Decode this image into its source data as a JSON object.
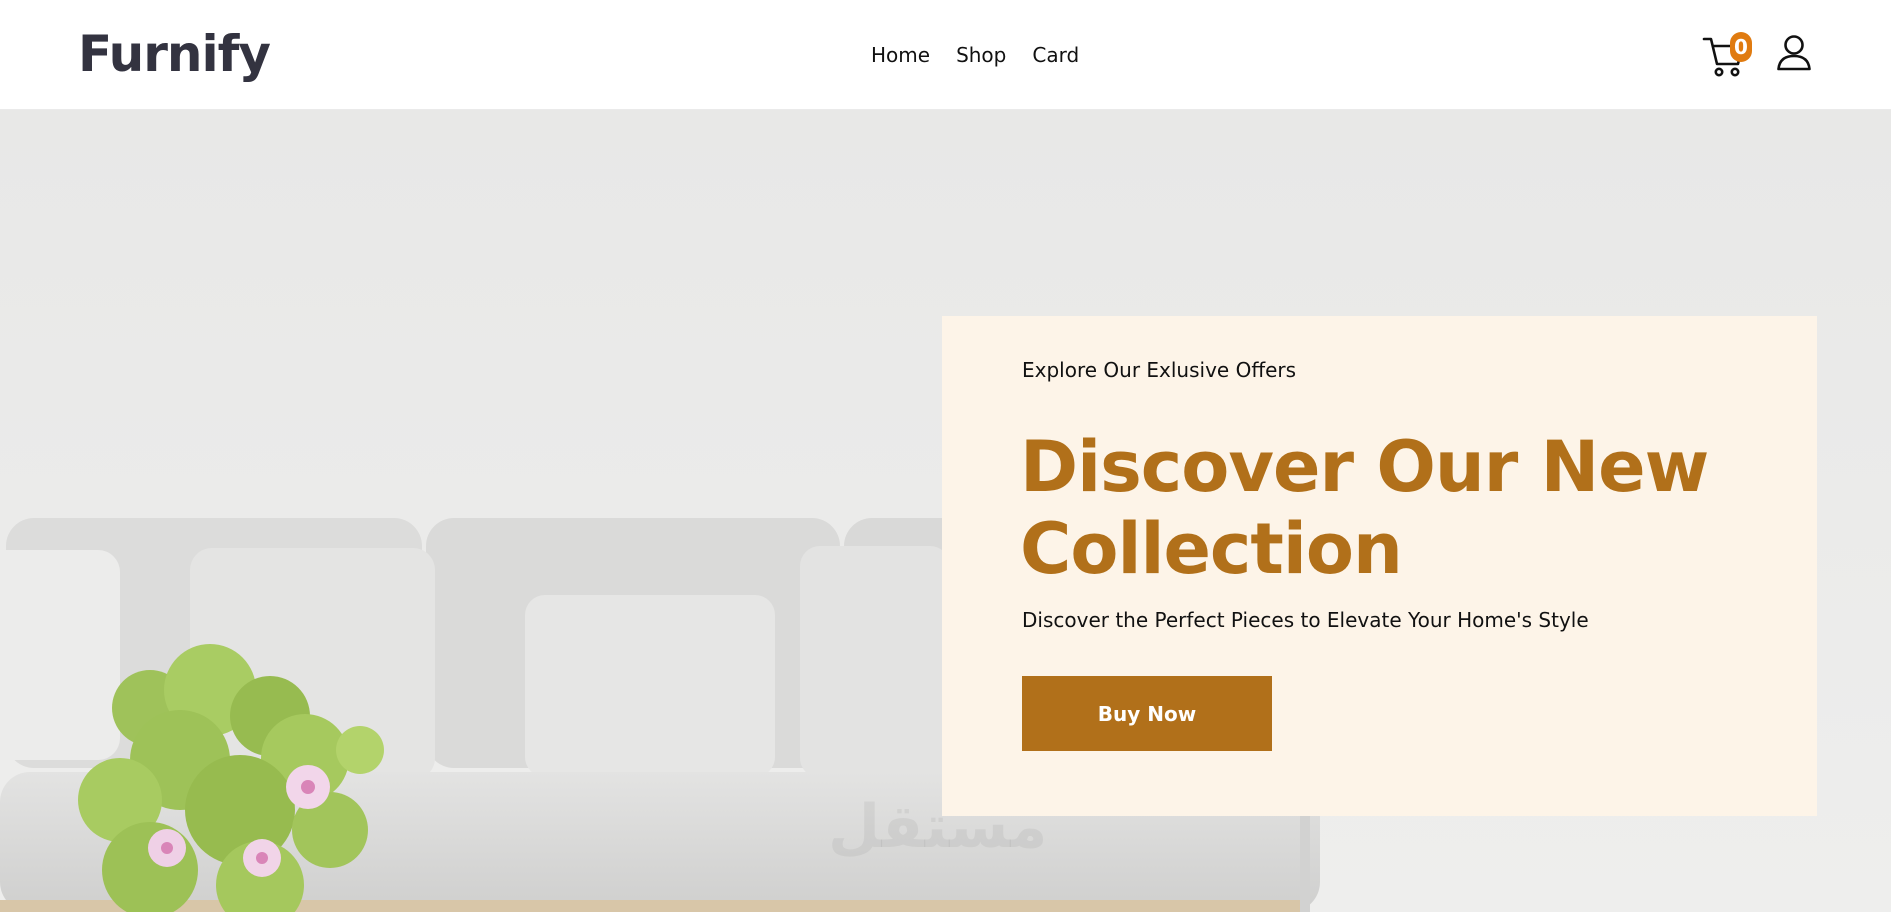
{
  "header": {
    "logo": "Furnify",
    "nav": [
      {
        "label": "Home"
      },
      {
        "label": "Shop"
      },
      {
        "label": "Card"
      }
    ],
    "cart": {
      "icon": "cart-icon",
      "count": "0",
      "badge_color": "#e07b10"
    },
    "user": {
      "icon": "user-icon"
    }
  },
  "hero": {
    "background_image": "living room with grey sofa, cushions and flowering plant",
    "eyebrow": "Explore Our Exlusive Offers",
    "title": "Discover Our New Collection",
    "subtitle": "Discover the Perfect Pieces to Elevate Your Home's Style",
    "cta_label": "Buy Now",
    "accent_color": "#b1701a",
    "card_color": "#fdf4e8"
  },
  "watermark": "مستقل"
}
